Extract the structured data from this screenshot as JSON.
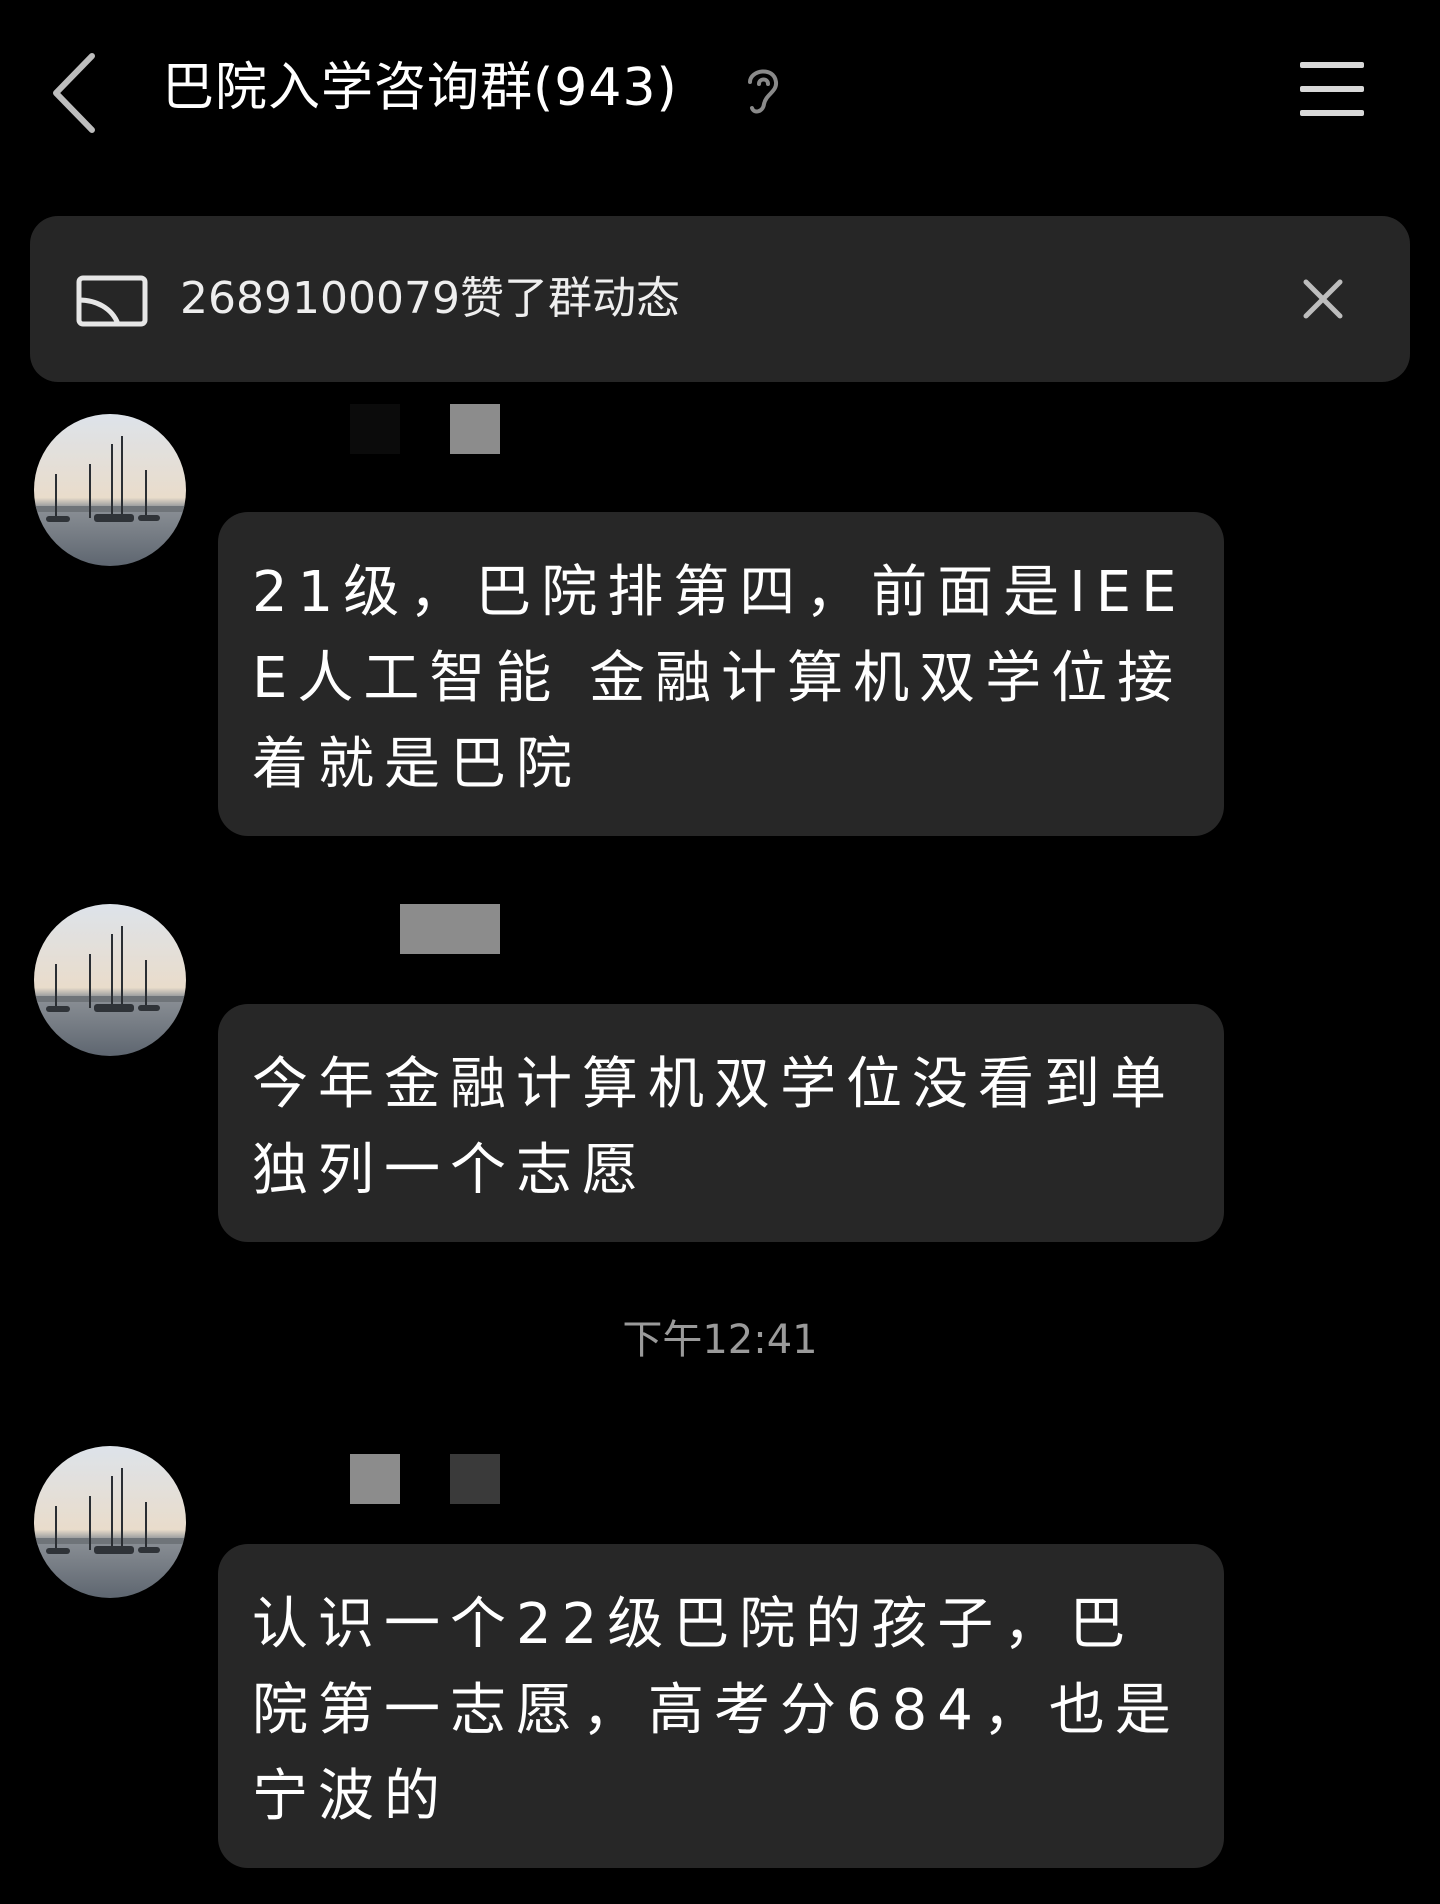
{
  "header": {
    "title": "巴院入学咨询群(943)"
  },
  "notice": {
    "text": "2689100079赞了群动态"
  },
  "timestamp": "下午12:41",
  "messages": [
    {
      "text": "21级，巴院排第四，前面是IEEE人工智能  金融计算机双学位接着就是巴院"
    },
    {
      "text": "今年金融计算机双学位没看到单独列一个志愿"
    },
    {
      "text": "认识一个22级巴院的孩子，巴院第一志愿，高考分684，也是宁波的"
    }
  ],
  "icons": {
    "back": "chevron-left-icon",
    "ear": "ear-icon",
    "menu": "hamburger-menu-icon",
    "notice": "cast-screen-icon",
    "close": "close-icon"
  },
  "colors": {
    "background": "#000000",
    "bubble": "#272727",
    "notice": "#262626",
    "text": "#ffffff",
    "muted": "#9a9a9a"
  }
}
